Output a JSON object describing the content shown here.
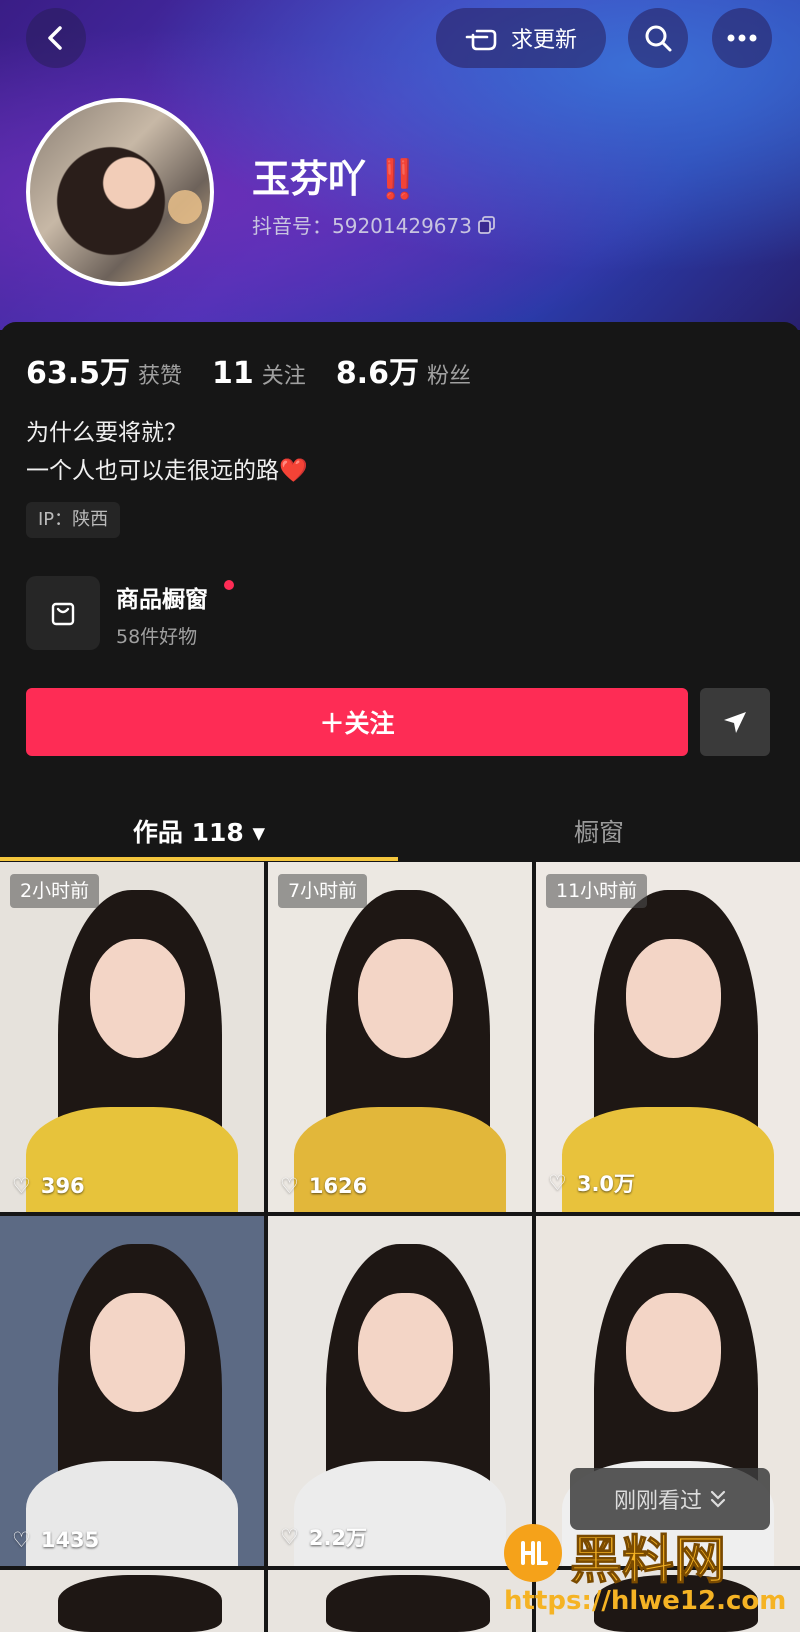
{
  "header": {
    "request_update_label": "求更新"
  },
  "profile": {
    "name": "玉芬吖",
    "name_emoji": "‼️",
    "douyin_id_label": "抖音号：59201429673"
  },
  "stats": [
    {
      "value": "63.5万",
      "label": "获赞"
    },
    {
      "value": "11",
      "label": "关注"
    },
    {
      "value": "8.6万",
      "label": "粉丝"
    }
  ],
  "bio": {
    "line1": "为什么要将就？",
    "line2": "一个人也可以走很远的路❤️"
  },
  "ip_label": "IP：陕西",
  "shop": {
    "title": "商品橱窗",
    "subtitle": "58件好物"
  },
  "actions": {
    "follow_label": "＋关注"
  },
  "tabs": {
    "works_label": "作品 118 ▾",
    "window_label": "橱窗"
  },
  "posts": [
    {
      "badge": "2小时前",
      "likes": "396",
      "top_color": "#e7c33b",
      "bg": "#e6e2dc"
    },
    {
      "badge": "7小时前",
      "likes": "1626",
      "top_color": "#e2b73a",
      "bg": "#ece8e2"
    },
    {
      "badge": "11小时前",
      "likes": "3.0万",
      "top_color": "#e8c23c",
      "bg": "#eee9e4"
    },
    {
      "badge": "",
      "likes": "1435",
      "top_color": "#e8e8e8",
      "bg": "#5c6a84"
    },
    {
      "badge": "",
      "likes": "2.2万",
      "top_color": "#ececec",
      "bg": "#e9e6e2"
    },
    {
      "badge": "",
      "likes": "",
      "top_color": "#efefef",
      "bg": "#ebe6e0"
    }
  ],
  "recent_viewed_label": "刚刚看过",
  "watermark": {
    "title": "黑料网",
    "url": "https://hlwe12.com"
  },
  "colors": {
    "accent": "#fe2c55",
    "tab_indicator": "#f4c63d"
  }
}
